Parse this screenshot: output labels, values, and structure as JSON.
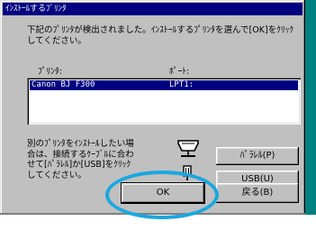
{
  "window": {
    "title": "ｲﾝｽﾄｰﾙするﾌﾟﾘﾝﾀ"
  },
  "instruction": "下記のﾌﾟﾘﾝﾀが検出されました。ｲﾝｽﾄｰﾙするﾌﾟﾘﾝﾀを選んで[OK]をｸﾘｯｸしてください。",
  "printer_list": {
    "column_printer": "ﾌﾟﾘﾝﾀ:",
    "column_port": "ﾎﾟｰﾄ:",
    "rows": [
      {
        "name": "Canon BJ F300",
        "port": "LPT1:",
        "selected": true
      }
    ]
  },
  "note": "別のﾌﾟﾘﾝﾀをｲﾝｽﾄｰﾙしたい場合は、接続するｹｰﾌﾞﾙに合わせて[ﾊﾟﾗﾚﾙ]か[USB]をｸﾘｯｸしてください。",
  "buttons": {
    "parallel": "ﾊﾟﾗﾚﾙ(P)",
    "usb": "USB(U)",
    "ok": "OK",
    "back": "戻る(B)"
  },
  "icons": {
    "parallel_connector": "parallel-connector-icon",
    "usb_connector": "usb-connector-icon"
  },
  "colors": {
    "dialog_face": "#c0c0c0",
    "titlebar": "#000080",
    "selection": "#000080",
    "highlight_ring": "#1aa7e0",
    "backdrop": "#008080"
  }
}
